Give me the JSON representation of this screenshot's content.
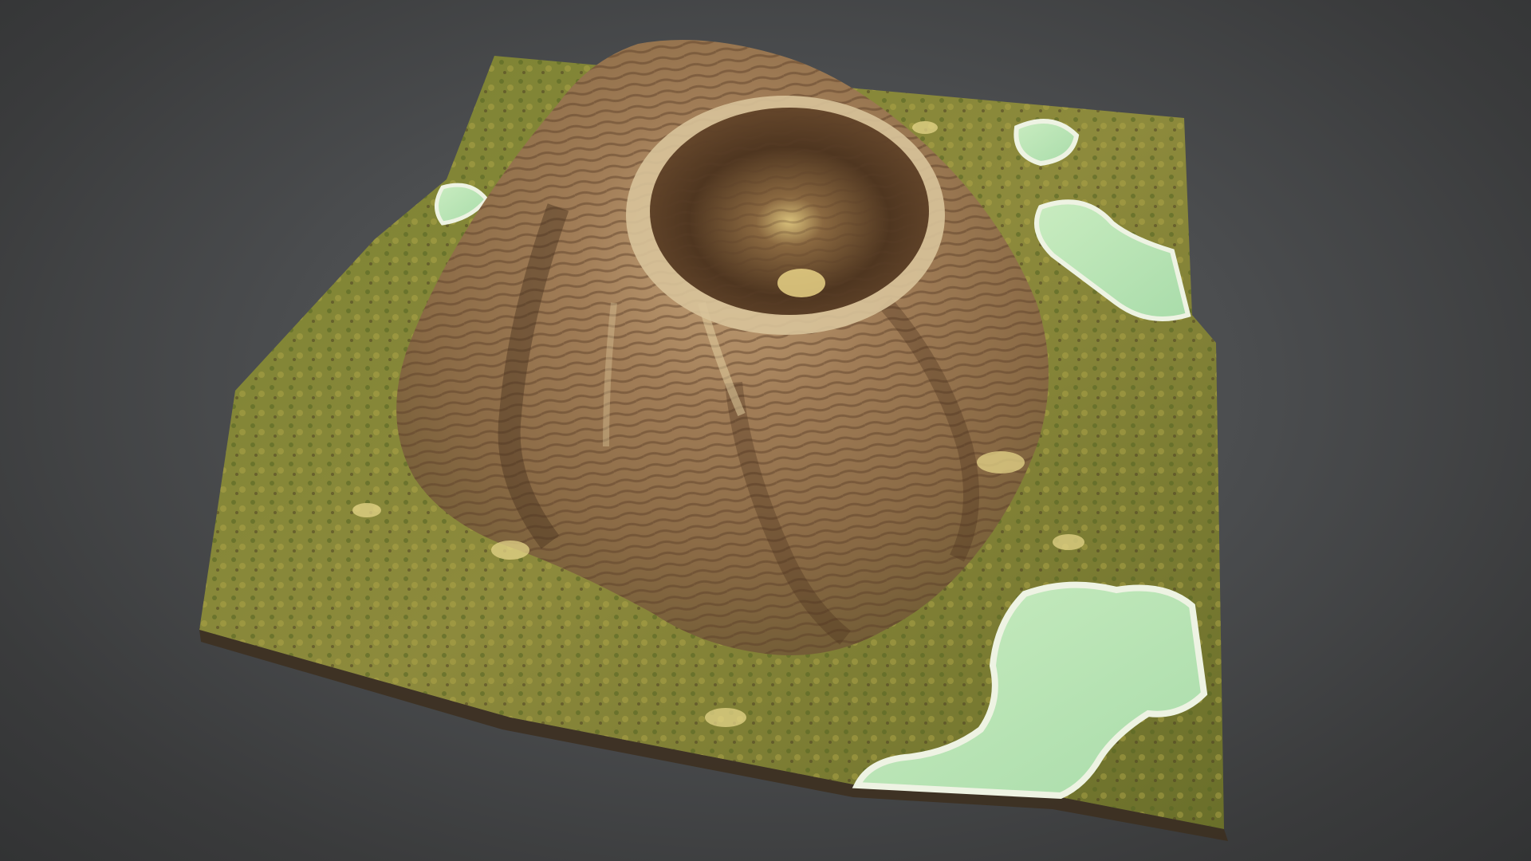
{
  "scene": {
    "subject": "volcano-terrain",
    "colors": {
      "background_center": "#5d5f61",
      "background_edge": "#323334",
      "grass": "#6f7a2e",
      "grass_light": "#a9a343",
      "rock_light": "#c9a97c",
      "rock_mid": "#9a7651",
      "rock_dark": "#5a3f28",
      "sand": "#e6d58a",
      "water": "#bfe6b6",
      "water_edge": "#eef3e3"
    }
  }
}
